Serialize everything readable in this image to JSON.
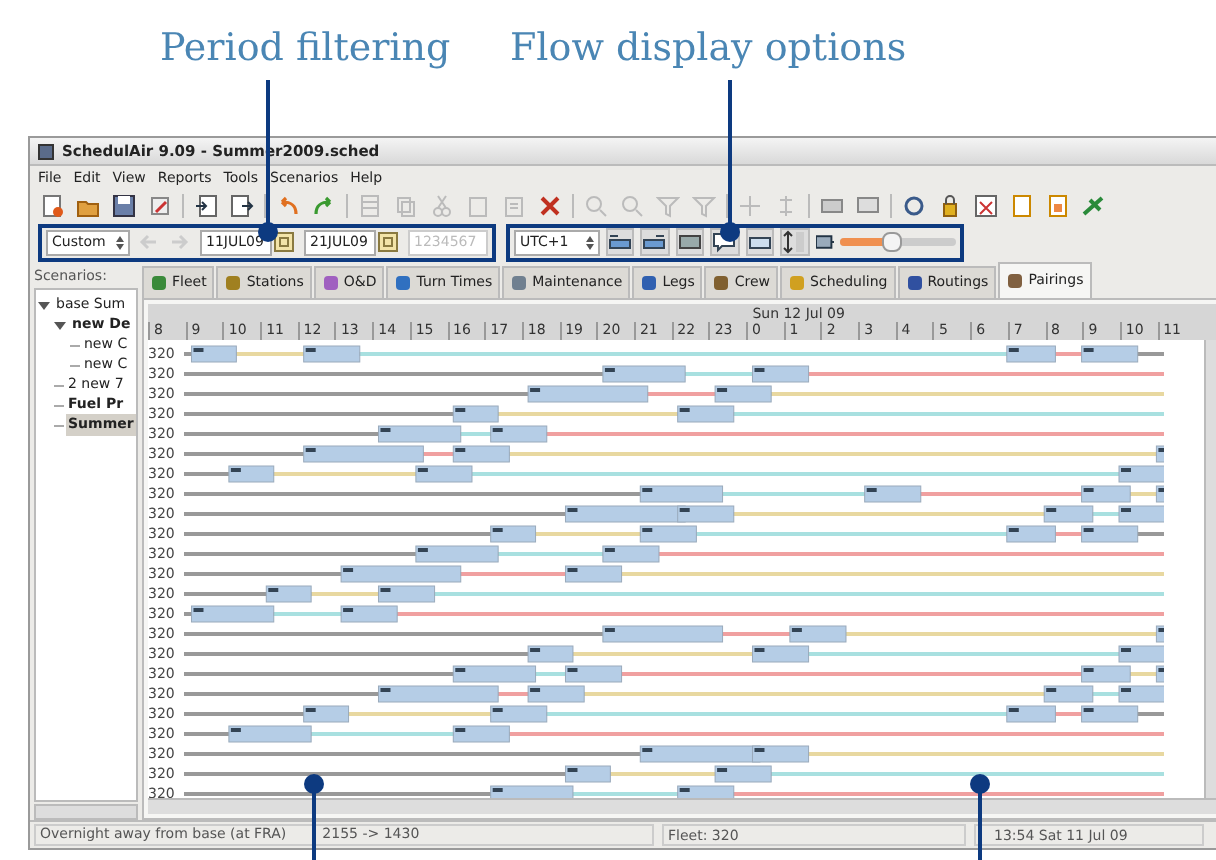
{
  "annotations": [
    {
      "label": "Period filtering"
    },
    {
      "label": "Flow display options"
    }
  ],
  "window": {
    "title": "SchedulAir 9.09 - Summer2009.sched"
  },
  "menu": [
    "File",
    "Edit",
    "View",
    "Reports",
    "Tools",
    "Scenarios",
    "Help"
  ],
  "period_filter": {
    "range": "Custom",
    "start_date": "11JUL09",
    "end_date": "21JUL09",
    "days": "1234567"
  },
  "flow_options": {
    "timezone": "UTC+1",
    "zoom": {
      "level": 0.45
    }
  },
  "scenarios": {
    "label": "Scenarios:",
    "tree": [
      {
        "label": "base Sum",
        "bold": false,
        "selected": false,
        "expanded": true,
        "children": [
          {
            "label": "new De",
            "bold": true,
            "selected": false,
            "expanded": true,
            "children": [
              {
                "label": "new C",
                "bold": false,
                "selected": false
              },
              {
                "label": "new C",
                "bold": false,
                "selected": false
              }
            ]
          },
          {
            "label": "2 new 7",
            "bold": false,
            "selected": false
          },
          {
            "label": "Fuel Pr",
            "bold": true,
            "selected": false
          },
          {
            "label": "Summer",
            "bold": true,
            "selected": true
          }
        ]
      }
    ]
  },
  "tabs": [
    {
      "label": "Fleet",
      "selected": false
    },
    {
      "label": "Stations",
      "selected": false
    },
    {
      "label": "O&D",
      "selected": false
    },
    {
      "label": "Turn Times",
      "selected": false
    },
    {
      "label": "Maintenance",
      "selected": false
    },
    {
      "label": "Legs",
      "selected": false
    },
    {
      "label": "Crew",
      "selected": false
    },
    {
      "label": "Scheduling",
      "selected": false
    },
    {
      "label": "Routings",
      "selected": false
    },
    {
      "label": "Pairings",
      "selected": true
    }
  ],
  "gantt": {
    "date": "Sun 12 Jul 09",
    "hours": [
      "8",
      "9",
      "10",
      "11",
      "12",
      "13",
      "14",
      "15",
      "16",
      "17",
      "18",
      "19",
      "20",
      "21",
      "22",
      "23",
      "0",
      "1",
      "2",
      "3",
      "4",
      "5",
      "6",
      "7",
      "8",
      "9",
      "10",
      "11"
    ],
    "rows": [
      "320",
      "320",
      "320",
      "320",
      "320",
      "320",
      "320",
      "320",
      "320",
      "320",
      "320",
      "320",
      "320",
      "320",
      "320",
      "320",
      "320",
      "320",
      "320",
      "320",
      "320",
      "320",
      "320"
    ]
  },
  "status_bar": {
    "message": "Overnight away from base (at FRA)",
    "times": "2155 -> 1430",
    "fleet": "Fleet: 320",
    "clock": "13:54 Sat 11 Jul 09"
  }
}
